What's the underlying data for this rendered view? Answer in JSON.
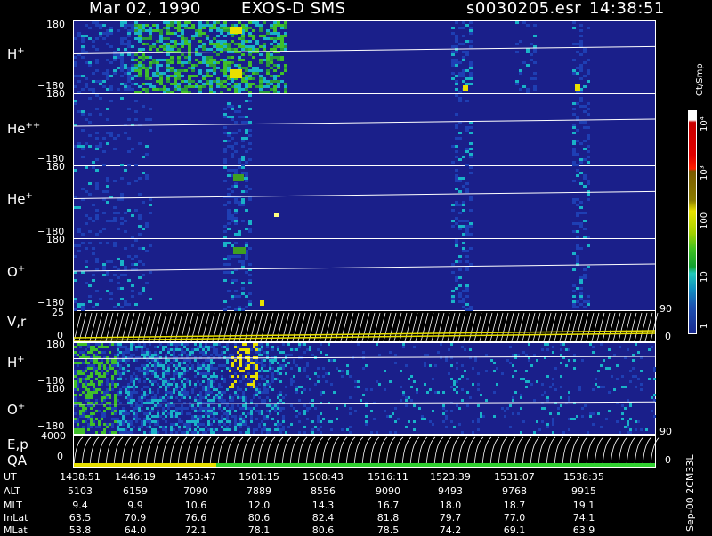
{
  "header": {
    "date": "Mar 02, 1990",
    "instrument": "EXOS-D SMS",
    "file": "s0030205.esr",
    "time": "14:38:51"
  },
  "panels": [
    {
      "base": "H",
      "sup": "+",
      "top_tick": "180",
      "bottom_tick": "−180"
    },
    {
      "base": "He",
      "sup": "++",
      "top_tick": "180",
      "bottom_tick": "−180"
    },
    {
      "base": "He",
      "sup": "+",
      "top_tick": "180",
      "bottom_tick": "−180"
    },
    {
      "base": "O",
      "sup": "+",
      "top_tick": "180",
      "bottom_tick": "−180"
    },
    {
      "base": "V,r",
      "sup": "",
      "top_tick": "25",
      "bottom_tick": "0",
      "right_top": "90",
      "right_bottom": "0"
    },
    {
      "base": "H",
      "sup": "+",
      "top_tick": "180",
      "bottom_tick": "−180"
    },
    {
      "base": "O",
      "sup": "+",
      "top_tick": "180",
      "bottom_tick": "−180"
    },
    {
      "base": "E,p",
      "sub": "QA",
      "top_tick": "4000",
      "bottom_tick": "0",
      "right_top": "90",
      "right_bottom": "0"
    }
  ],
  "colorbar": {
    "unit": "Ct/Smp",
    "labels": [
      "10⁴",
      "10³",
      "100",
      "10",
      "1"
    ]
  },
  "side_code": "Sep-00  2CM33L",
  "table": {
    "rows": [
      {
        "label": "UT",
        "values": [
          "1438:51",
          "1446:19",
          "1453:47",
          "1501:15",
          "1508:43",
          "1516:11",
          "1523:39",
          "1531:07",
          "1538:35"
        ]
      },
      {
        "label": "ALT",
        "values": [
          "5103",
          "6159",
          "7090",
          "7889",
          "8556",
          "9090",
          "9493",
          "9768",
          "9915"
        ]
      },
      {
        "label": "MLT",
        "values": [
          "9.4",
          "9.9",
          "10.6",
          "12.0",
          "14.3",
          "16.7",
          "18.0",
          "18.7",
          "19.1"
        ]
      },
      {
        "label": "InLat",
        "values": [
          "63.5",
          "70.9",
          "76.6",
          "80.6",
          "82.4",
          "81.8",
          "79.7",
          "77.0",
          "74.1"
        ]
      },
      {
        "label": "MLat",
        "values": [
          "53.8",
          "64.0",
          "72.1",
          "78.1",
          "80.6",
          "78.5",
          "74.2",
          "69.1",
          "63.9"
        ]
      }
    ]
  },
  "chart_data": {
    "type": "heatmap",
    "title": "Mar 02, 1990   EXOS-D SMS",
    "x": [
      "1438:51",
      "1446:19",
      "1453:47",
      "1501:15",
      "1508:43",
      "1516:11",
      "1523:39",
      "1531:07",
      "1538:35"
    ],
    "series": [
      {
        "name": "H+",
        "ylim": [
          -180,
          180
        ]
      },
      {
        "name": "He++",
        "ylim": [
          -180,
          180
        ]
      },
      {
        "name": "He+",
        "ylim": [
          -180,
          180
        ]
      },
      {
        "name": "O+",
        "ylim": [
          -180,
          180
        ]
      },
      {
        "name": "V,r",
        "ylim": [
          0,
          25
        ],
        "right_ylim": [
          0,
          90
        ]
      },
      {
        "name": "H+",
        "ylim": [
          -180,
          180
        ]
      },
      {
        "name": "O+",
        "ylim": [
          -180,
          180
        ]
      },
      {
        "name": "E,p",
        "ylim": [
          0,
          4000
        ],
        "right_ylim": [
          0,
          90
        ]
      }
    ],
    "colorbar_unit": "Ct/Smp",
    "colorbar_ticks": [
      "1",
      "10",
      "100",
      "10³",
      "10⁴"
    ],
    "colors": {
      "background": "#1a1f8a",
      "low": "#1e3fb4",
      "mid": "#19b2c8",
      "high": "#3fbf2a",
      "peak": "#e8e000"
    }
  }
}
